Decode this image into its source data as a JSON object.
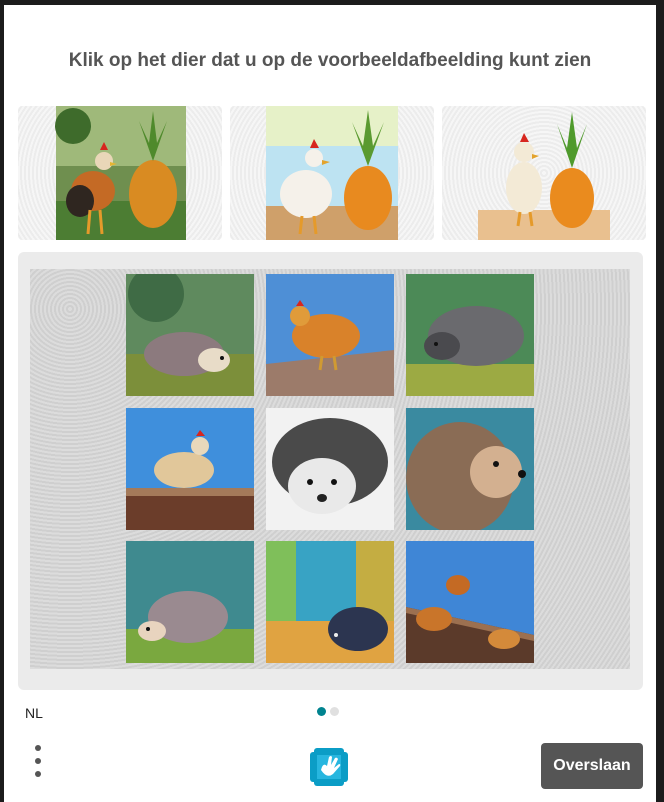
{
  "challenge": {
    "prompt": "Klik op het dier dat u op de voorbeeldafbeelding kunt zien"
  },
  "examples": [
    {
      "subject": "rooster and pineapple"
    },
    {
      "subject": "rooster and pineapple"
    },
    {
      "subject": "chicken and pineapple"
    }
  ],
  "grid": {
    "tiles": [
      {
        "subject": "hedgehog"
      },
      {
        "subject": "chicken on rooftop"
      },
      {
        "subject": "hedgehog"
      },
      {
        "subject": "chicken on rooftop"
      },
      {
        "subject": "hedgehog"
      },
      {
        "subject": "hedgehog"
      },
      {
        "subject": "hedgehog"
      },
      {
        "subject": "hedgehog in forest"
      },
      {
        "subject": "chickens on rooftop"
      }
    ]
  },
  "footer": {
    "language": "NL",
    "page_indicator": {
      "current": 1,
      "total": 2
    },
    "skip_label": "Overslaan",
    "menu_icon": "more-vertical-icon",
    "logo_icon": "hand-logo-icon"
  },
  "colors": {
    "accent": "#00838f",
    "button": "#555555"
  }
}
